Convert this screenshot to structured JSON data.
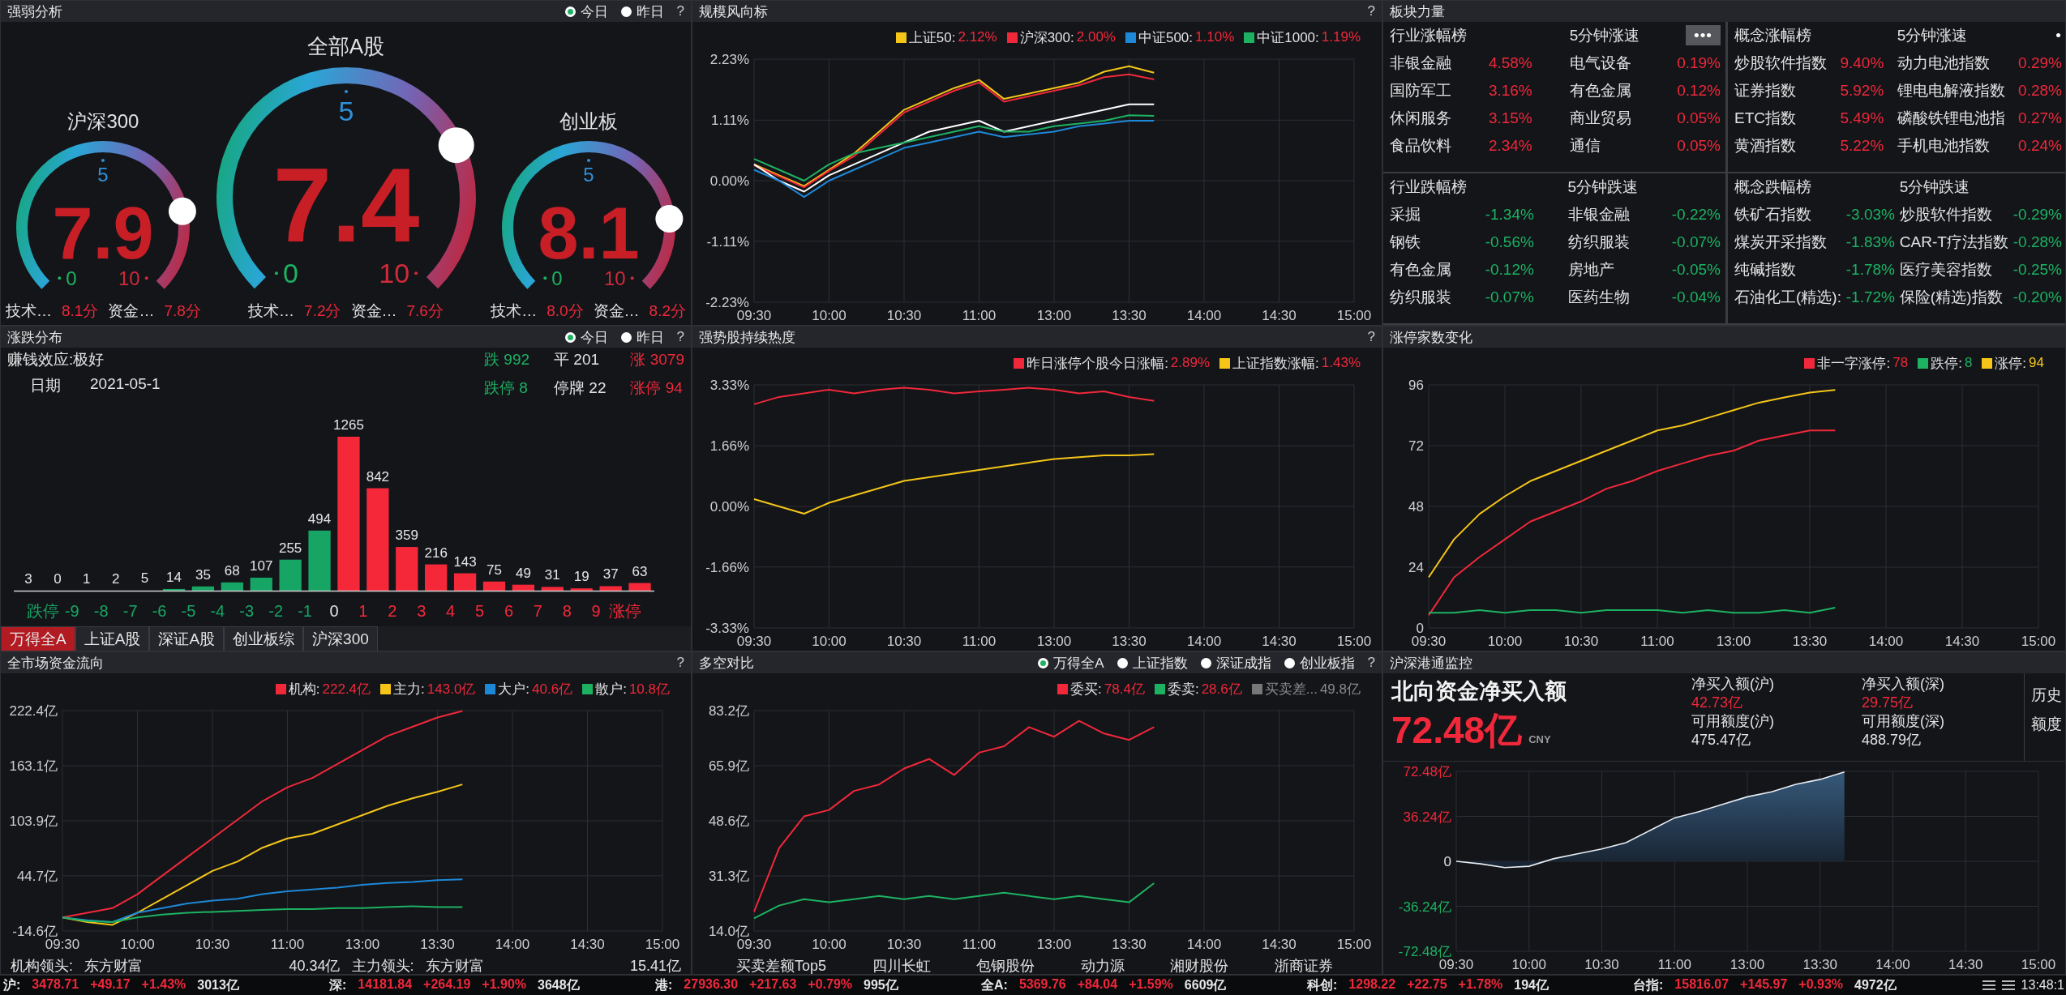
{
  "strength": {
    "title": "强弱分析",
    "radios": [
      {
        "label": "今日",
        "selected": true
      },
      {
        "label": "昨日",
        "selected": false
      }
    ],
    "help": "?",
    "gauges": [
      {
        "kind": "small",
        "title": "沪深300",
        "value": "7.9",
        "min": "0",
        "mid": "5",
        "max": "10",
        "scores": [
          {
            "label": "技术…",
            "value": "8.1分"
          },
          {
            "label": "资金…",
            "value": "7.8分"
          }
        ]
      },
      {
        "kind": "large",
        "title": "全部A股",
        "value": "7.4",
        "min": "0",
        "mid": "5",
        "max": "10",
        "scores": [
          {
            "label": "技术…",
            "value": "7.2分"
          },
          {
            "label": "资金…",
            "value": "7.6分"
          }
        ]
      },
      {
        "kind": "small",
        "title": "创业板",
        "value": "8.1",
        "min": "0",
        "mid": "5",
        "max": "10",
        "scores": [
          {
            "label": "技术…",
            "value": "8.0分"
          },
          {
            "label": "资金…",
            "value": "8.2分"
          }
        ]
      }
    ]
  },
  "scale_indicator": {
    "title": "规模风向标",
    "help": "?",
    "legend": [
      {
        "name": "上证50:",
        "value": "2.12%",
        "color": "#f5c518"
      },
      {
        "name": "沪深300:",
        "value": "2.00%",
        "color": "#f0283a"
      },
      {
        "name": "中证500:",
        "value": "1.10%",
        "color": "#1e88d8"
      },
      {
        "name": "中证1000:",
        "value": "1.19%",
        "color": "#1db262"
      }
    ],
    "chart_data": {
      "type": "line",
      "grid": true,
      "categories": [
        "09:30",
        null,
        null,
        "10:00",
        null,
        null,
        "10:30",
        null,
        null,
        "11:00",
        null,
        null,
        "13:00",
        null,
        null,
        "13:30",
        null,
        null,
        "14:00",
        null,
        null,
        "14:30",
        null,
        null,
        "15:00"
      ],
      "ylim": [
        -2.23,
        2.23
      ],
      "yticks": [
        {
          "value": 2.23,
          "label": "2.23%"
        },
        {
          "value": 1.11,
          "label": "1.11%"
        },
        {
          "value": 0,
          "label": "0.00%"
        },
        {
          "value": -1.11,
          "label": "-1.11%"
        },
        {
          "value": -2.23,
          "label": "-2.23%"
        }
      ],
      "series": [
        {
          "color": "#f5c518",
          "values": [
            0.3,
            0.1,
            -0.1,
            0.2,
            0.5,
            0.9,
            1.3,
            1.5,
            1.7,
            1.85,
            1.5,
            1.6,
            1.7,
            1.8,
            2.0,
            2.1,
            1.98,
            null,
            null,
            null,
            null,
            null,
            null,
            null,
            null
          ]
        },
        {
          "color": "#f0283a",
          "values": [
            0.28,
            0.08,
            -0.12,
            0.18,
            0.45,
            0.85,
            1.25,
            1.45,
            1.65,
            1.8,
            1.45,
            1.55,
            1.65,
            1.75,
            1.9,
            1.95,
            1.86,
            null,
            null,
            null,
            null,
            null,
            null,
            null,
            null
          ]
        },
        {
          "color": "#ffffff",
          "values": [
            0.3,
            0.0,
            -0.2,
            0.1,
            0.3,
            0.5,
            0.7,
            0.9,
            1.0,
            1.1,
            0.9,
            1.0,
            1.1,
            1.2,
            1.3,
            1.4,
            1.4,
            null,
            null,
            null,
            null,
            null,
            null,
            null,
            null
          ]
        },
        {
          "color": "#1e88d8",
          "values": [
            0.2,
            0.0,
            -0.3,
            0.0,
            0.2,
            0.4,
            0.6,
            0.7,
            0.8,
            0.9,
            0.8,
            0.85,
            0.9,
            1.0,
            1.05,
            1.1,
            1.1,
            null,
            null,
            null,
            null,
            null,
            null,
            null,
            null
          ]
        },
        {
          "color": "#1db262",
          "values": [
            0.4,
            0.2,
            0.0,
            0.3,
            0.5,
            0.6,
            0.7,
            0.8,
            0.9,
            1.0,
            0.9,
            0.9,
            1.0,
            1.05,
            1.1,
            1.2,
            1.19,
            null,
            null,
            null,
            null,
            null,
            null,
            null,
            null
          ]
        }
      ]
    }
  },
  "sector_strength": {
    "title": "板块力量",
    "tables": [
      {
        "kind": "rise",
        "title": "行业涨幅榜",
        "speed_title": "5分钟涨速",
        "more": "•••",
        "rows": [
          {
            "name": "非银金融",
            "change": "4.58%",
            "name_2": "电气设备",
            "change_2": "0.19%"
          },
          {
            "name": "国防军工",
            "change": "3.16%",
            "name_2": "有色金属",
            "change_2": "0.12%"
          },
          {
            "name": "休闲服务",
            "change": "3.15%",
            "name_2": "商业贸易",
            "change_2": "0.05%"
          },
          {
            "name": "食品饮料",
            "change": "2.34%",
            "name_2": "通信",
            "change_2": "0.05%"
          }
        ]
      },
      {
        "kind": "rise",
        "title": "概念涨幅榜",
        "speed_title": "5分钟涨速",
        "more": "•",
        "rows": [
          {
            "name": "炒股软件指数",
            "change": "9.40%",
            "name_2": "动力电池指数",
            "change_2": "0.29%"
          },
          {
            "name": "证券指数",
            "change": "5.92%",
            "name_2": "锂电电解液指数",
            "change_2": "0.28%"
          },
          {
            "name": "ETC指数",
            "change": "5.49%",
            "name_2": "磷酸铁锂电池指",
            "change_2": "0.27%"
          },
          {
            "name": "黄酒指数",
            "change": "5.22%",
            "name_2": "手机电池指数",
            "change_2": "0.24%"
          }
        ]
      },
      {
        "kind": "fall",
        "title": "行业跌幅榜",
        "speed_title": "5分钟跌速",
        "rows": [
          {
            "name": "采掘",
            "change": "-1.34%",
            "name_2": "非银金融",
            "change_2": "-0.22%"
          },
          {
            "name": "钢铁",
            "change": "-0.56%",
            "name_2": "纺织服装",
            "change_2": "-0.07%"
          },
          {
            "name": "有色金属",
            "change": "-0.12%",
            "name_2": "房地产",
            "change_2": "-0.05%"
          },
          {
            "name": "纺织服装",
            "change": "-0.07%",
            "name_2": "医药生物",
            "change_2": "-0.04%"
          }
        ]
      },
      {
        "kind": "fall",
        "title": "概念跌幅榜",
        "speed_title": "5分钟跌速",
        "rows": [
          {
            "name": "铁矿石指数",
            "change": "-3.03%",
            "name_2": "炒股软件指数",
            "change_2": "-0.29%"
          },
          {
            "name": "煤炭开采指数",
            "change": "-1.83%",
            "name_2": "CAR-T疗法指数",
            "change_2": "-0.28%"
          },
          {
            "name": "纯碱指数",
            "change": "-1.78%",
            "name_2": "医疗美容指数",
            "change_2": "-0.25%"
          },
          {
            "name": "石油化工(精选):",
            "change": "-1.72%",
            "name_2": "保险(精选)指数",
            "change_2": "-0.20%"
          }
        ]
      }
    ]
  },
  "distribution": {
    "title": "涨跌分布",
    "radios": [
      {
        "label": "今日",
        "selected": true
      },
      {
        "label": "昨日",
        "selected": false
      }
    ],
    "help": "?",
    "effect": "赚钱效应:极好",
    "date_label": "日期",
    "date": "2021-05-1",
    "counts": [
      {
        "text": "跌 992",
        "kind": "fall"
      },
      {
        "text": "平 201",
        "kind": "flat"
      },
      {
        "text": "涨 3079",
        "kind": "rise"
      },
      {
        "text": "跌停 8",
        "kind": "fall"
      },
      {
        "text": "停牌 22",
        "kind": "flat"
      },
      {
        "text": "涨停 94",
        "kind": "rise"
      }
    ],
    "chart_data": {
      "type": "bar",
      "data_labels": true,
      "x": [
        -10.5,
        -9.5,
        -8.5,
        -7.5,
        -6.5,
        -5.5,
        -4.5,
        -3.5,
        -2.5,
        -1.5,
        -0.5,
        0.5,
        1.5,
        2.5,
        3.5,
        4.5,
        5.5,
        6.5,
        7.5,
        8.5,
        9.5,
        10.5
      ],
      "xlim": [
        -11,
        11
      ],
      "xticks": [
        {
          "value": -10,
          "label": "跌停"
        },
        -9,
        -8,
        -7,
        -6,
        -5,
        -4,
        -3,
        -2,
        -1,
        0,
        1,
        2,
        3,
        4,
        5,
        6,
        7,
        8,
        9,
        {
          "value": 10,
          "label": "涨停"
        }
      ],
      "series": [
        {
          "color": "#17a565",
          "values": [
            3,
            0,
            1,
            2,
            5,
            14,
            35,
            68,
            107,
            255,
            494,
            null,
            null,
            null,
            null,
            null,
            null,
            null,
            null,
            null,
            null,
            null
          ]
        },
        {
          "color": "#f5283a",
          "values": [
            null,
            null,
            null,
            null,
            null,
            null,
            null,
            null,
            null,
            null,
            null,
            1265,
            842,
            359,
            216,
            143,
            75,
            49,
            31,
            19,
            37,
            63
          ]
        }
      ]
    },
    "tabs": [
      {
        "label": "万得全A",
        "selected": true
      },
      {
        "label": "上证A股",
        "selected": false
      },
      {
        "label": "深证A股",
        "selected": false
      },
      {
        "label": "创业板综",
        "selected": false
      },
      {
        "label": "沪深300",
        "selected": false
      }
    ]
  },
  "stock_heat": {
    "title": "强势股持续热度",
    "help": "?",
    "legend": [
      {
        "name": "昨日涨停个股今日涨幅:",
        "value": "2.89%",
        "color": "#f0283a"
      },
      {
        "name": "上证指数涨幅:",
        "value": "1.43%",
        "color": "#f5c518"
      }
    ],
    "chart_data": {
      "type": "line",
      "grid": true,
      "categories": [
        "09:30",
        null,
        null,
        "10:00",
        null,
        null,
        "10:30",
        null,
        null,
        "11:00",
        null,
        null,
        "13:00",
        null,
        null,
        "13:30",
        null,
        null,
        "14:00",
        null,
        null,
        "14:30",
        null,
        null,
        "15:00"
      ],
      "ylim": [
        -3.33,
        3.33
      ],
      "yticks": [
        {
          "value": 3.33,
          "label": "3.33%"
        },
        {
          "value": 1.66,
          "label": "1.66%"
        },
        {
          "value": 0,
          "label": "0.00%"
        },
        {
          "value": -1.66,
          "label": "-1.66%"
        },
        {
          "value": -3.33,
          "label": "-3.33%"
        }
      ],
      "series": [
        {
          "color": "#f0283a",
          "values": [
            2.8,
            3.0,
            3.1,
            3.2,
            3.1,
            3.2,
            3.25,
            3.2,
            3.1,
            3.15,
            3.2,
            3.25,
            3.2,
            3.1,
            3.15,
            3.0,
            2.89,
            null,
            null,
            null,
            null,
            null,
            null,
            null,
            null
          ]
        },
        {
          "color": "#f5c518",
          "values": [
            0.2,
            0.0,
            -0.2,
            0.1,
            0.3,
            0.5,
            0.7,
            0.8,
            0.9,
            1.0,
            1.1,
            1.2,
            1.3,
            1.35,
            1.4,
            1.4,
            1.43,
            null,
            null,
            null,
            null,
            null,
            null,
            null,
            null
          ]
        }
      ]
    }
  },
  "limit_count": {
    "title": "涨停家数变化",
    "legend": [
      {
        "name": "非一字涨停:",
        "value": "78",
        "color": "#f0283a"
      },
      {
        "name": "跌停:",
        "value": "8",
        "color": "#1db262"
      },
      {
        "name": "涨停:",
        "value": "94",
        "color": "#f5c518"
      }
    ],
    "chart_data": {
      "type": "line",
      "grid": true,
      "categories": [
        "09:30",
        null,
        null,
        "10:00",
        null,
        null,
        "10:30",
        null,
        null,
        "11:00",
        null,
        null,
        "13:00",
        null,
        null,
        "13:30",
        null,
        null,
        "14:00",
        null,
        null,
        "14:30",
        null,
        null,
        "15:00"
      ],
      "ylim": [
        0,
        96
      ],
      "yticks": [
        96,
        72,
        48,
        24,
        0
      ],
      "series": [
        {
          "color": "#f0283a",
          "values": [
            5,
            20,
            28,
            35,
            42,
            46,
            50,
            55,
            58,
            62,
            65,
            68,
            70,
            74,
            76,
            78,
            78,
            null,
            null,
            null,
            null,
            null,
            null,
            null,
            null
          ]
        },
        {
          "color": "#1db262",
          "values": [
            6,
            6,
            7,
            6,
            7,
            7,
            6,
            7,
            7,
            7,
            6,
            7,
            6,
            6,
            7,
            6,
            8,
            null,
            null,
            null,
            null,
            null,
            null,
            null,
            null
          ]
        },
        {
          "color": "#f5c518",
          "values": [
            20,
            35,
            45,
            52,
            58,
            62,
            66,
            70,
            74,
            78,
            80,
            83,
            86,
            89,
            91,
            93,
            94,
            null,
            null,
            null,
            null,
            null,
            null,
            null,
            null
          ]
        }
      ]
    }
  },
  "fund_flow": {
    "title": "全市场资金流向",
    "help": "?",
    "legend": [
      {
        "name": "机构:",
        "value": "222.4亿",
        "color": "#f0283a"
      },
      {
        "name": "主力:",
        "value": "143.0亿",
        "color": "#f5c518"
      },
      {
        "name": "大户:",
        "value": "40.6亿",
        "color": "#1e88d8"
      },
      {
        "name": "散户:",
        "value": "10.8亿",
        "color": "#1db262"
      }
    ],
    "chart_data": {
      "type": "line",
      "grid": true,
      "categories": [
        "09:30",
        null,
        null,
        "10:00",
        null,
        null,
        "10:30",
        null,
        null,
        "11:00",
        null,
        null,
        "13:00",
        null,
        null,
        "13:30",
        null,
        null,
        "14:00",
        null,
        null,
        "14:30",
        null,
        null,
        "15:00"
      ],
      "ylim": [
        -14.6,
        222.4
      ],
      "yticks": [
        {
          "value": 222.4,
          "label": "222.4亿"
        },
        {
          "value": 163.1,
          "label": "163.1亿"
        },
        {
          "value": 103.9,
          "label": "103.9亿"
        },
        {
          "value": 44.7,
          "label": "44.7亿"
        },
        {
          "value": -14.6,
          "label": "-14.6亿"
        }
      ],
      "series": [
        {
          "color": "#f0283a",
          "values": [
            0,
            5,
            10,
            25,
            45,
            65,
            85,
            105,
            125,
            140,
            150,
            165,
            180,
            195,
            205,
            215,
            222,
            null,
            null,
            null,
            null,
            null,
            null,
            null,
            null
          ]
        },
        {
          "color": "#f5c518",
          "values": [
            0,
            -5,
            -8,
            5,
            20,
            35,
            50,
            60,
            75,
            85,
            90,
            100,
            110,
            120,
            128,
            135,
            143,
            null,
            null,
            null,
            null,
            null,
            null,
            null,
            null
          ]
        },
        {
          "color": "#1e88d8",
          "values": [
            0,
            -3,
            -5,
            5,
            10,
            15,
            18,
            20,
            25,
            28,
            30,
            32,
            35,
            37,
            38,
            40,
            41,
            null,
            null,
            null,
            null,
            null,
            null,
            null,
            null
          ]
        },
        {
          "color": "#1db262",
          "values": [
            0,
            -4,
            -5,
            0,
            3,
            5,
            6,
            7,
            8,
            9,
            9,
            10,
            10,
            11,
            12,
            11,
            11,
            null,
            null,
            null,
            null,
            null,
            null,
            null,
            null
          ]
        }
      ]
    },
    "footer": [
      "机构领头:",
      "东方财富",
      "40.34亿",
      "主力领头:",
      "东方财富",
      "15.41亿"
    ]
  },
  "long_short": {
    "title": "多空对比",
    "radios": [
      {
        "label": "万得全A",
        "selected": true
      },
      {
        "label": "上证指数",
        "selected": false
      },
      {
        "label": "深证成指",
        "selected": false
      },
      {
        "label": "创业板指",
        "selected": false
      }
    ],
    "help": "?",
    "legend": [
      {
        "name": "委买:",
        "value": "78.4亿",
        "color": "#f0283a",
        "on": true
      },
      {
        "name": "委卖:",
        "value": "28.6亿",
        "color": "#1db262",
        "on": true
      },
      {
        "name": "买卖差...",
        "value": "49.8亿",
        "color": "#777777",
        "on": false
      }
    ],
    "chart_data": {
      "type": "line",
      "grid": true,
      "categories": [
        "09:30",
        null,
        null,
        "10:00",
        null,
        null,
        "10:30",
        null,
        null,
        "11:00",
        null,
        null,
        "13:00",
        null,
        null,
        "13:30",
        null,
        null,
        "14:00",
        null,
        null,
        "14:30",
        null,
        null,
        "15:00"
      ],
      "ylim": [
        14.0,
        83.2
      ],
      "yticks": [
        {
          "value": 83.2,
          "label": "83.2亿"
        },
        {
          "value": 65.9,
          "label": "65.9亿"
        },
        {
          "value": 48.6,
          "label": "48.6亿"
        },
        {
          "value": 31.3,
          "label": "31.3亿"
        },
        {
          "value": 14.0,
          "label": "14.0亿"
        }
      ],
      "series": [
        {
          "color": "#f0283a",
          "values": [
            20,
            40,
            50,
            52,
            58,
            60,
            65,
            68,
            63,
            70,
            72,
            78,
            75,
            80,
            76,
            74,
            78,
            null,
            null,
            null,
            null,
            null,
            null,
            null,
            null
          ]
        },
        {
          "color": "#1db262",
          "values": [
            18,
            22,
            24,
            23,
            24,
            25,
            24,
            25,
            24,
            25,
            26,
            25,
            24,
            25,
            24,
            23,
            29,
            null,
            null,
            null,
            null,
            null,
            null,
            null,
            null
          ]
        }
      ]
    },
    "footer_title": "买卖差额Top5",
    "footer": [
      "四川长虹",
      "包钢股份",
      "动力源",
      "湘财股份",
      "浙商证券"
    ]
  },
  "connect": {
    "title": "沪深港通监控",
    "headline": "北向资金净买入额",
    "amount": "72.48亿",
    "unit": "CNY",
    "stats": [
      {
        "label": "净买入额(沪)",
        "value": "42.73亿",
        "kind": "rise"
      },
      {
        "label": "净买入额(深)",
        "value": "29.75亿",
        "kind": "rise"
      },
      {
        "label": "可用额度(沪)",
        "value": "475.47亿",
        "kind": "flat"
      },
      {
        "label": "可用额度(深)",
        "value": "488.79亿",
        "kind": "flat"
      }
    ],
    "history": [
      "历史",
      "额度"
    ],
    "chart_data": {
      "type": "area",
      "grid": true,
      "categories": [
        "09:30",
        null,
        null,
        "10:00",
        null,
        null,
        "10:30",
        null,
        null,
        "11:00",
        null,
        null,
        "13:00",
        null,
        null,
        "13:30",
        null,
        null,
        "14:00",
        null,
        null,
        "14:30",
        null,
        null,
        "15:00"
      ],
      "ylim": [
        -72.48,
        72.48
      ],
      "yticks": [
        {
          "value": 72.48,
          "label": "72.48亿"
        },
        {
          "value": 36.24,
          "label": "36.24亿"
        },
        {
          "value": 0,
          "label": "0"
        },
        {
          "value": -36.24,
          "label": "-36.24亿"
        },
        {
          "value": -72.48,
          "label": "-72.48亿"
        }
      ],
      "series": [
        {
          "color": "#e8eef5",
          "values": [
            0,
            -2,
            -5,
            -4,
            2,
            6,
            10,
            15,
            25,
            35,
            40,
            46,
            52,
            56,
            62,
            66,
            72,
            null,
            null,
            null,
            null,
            null,
            null,
            null,
            null
          ]
        }
      ]
    }
  },
  "status_bar": {
    "items": [
      {
        "market": "沪:",
        "price": "3478.71",
        "change": "+49.17",
        "pct": "+1.43%",
        "amount": "3013亿"
      },
      {
        "market": "深:",
        "price": "14181.84",
        "change": "+264.19",
        "pct": "+1.90%",
        "amount": "3648亿"
      },
      {
        "market": "港:",
        "price": "27936.30",
        "change": "+217.63",
        "pct": "+0.79%",
        "amount": "995亿"
      },
      {
        "market": "全A:",
        "price": "5369.76",
        "change": "+84.04",
        "pct": "+1.59%",
        "amount": "6609亿"
      },
      {
        "market": "科创:",
        "price": "1298.22",
        "change": "+22.75",
        "pct": "+1.78%",
        "amount": "194亿"
      },
      {
        "market": "台指:",
        "price": "15816.07",
        "change": "+145.97",
        "pct": "+0.93%",
        "amount": "4972亿"
      }
    ],
    "time": "13:48:1"
  }
}
